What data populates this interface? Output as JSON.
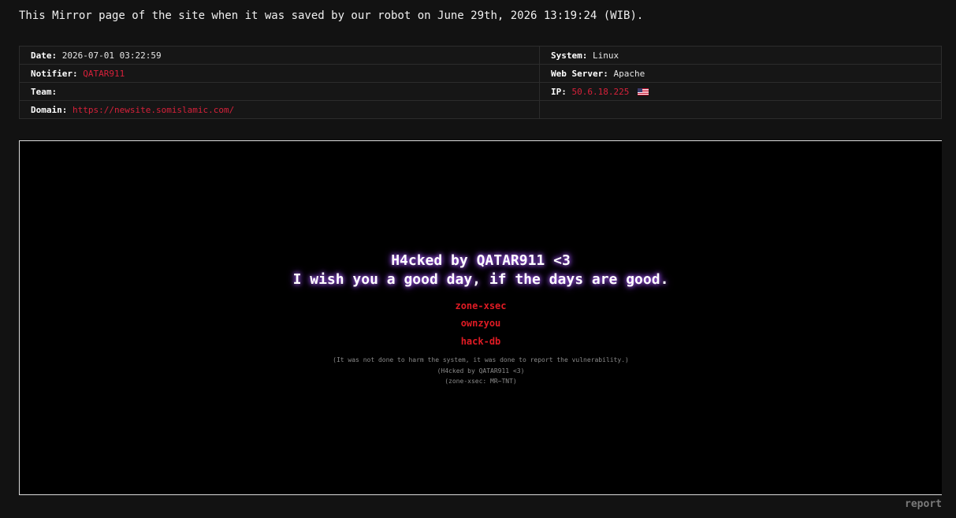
{
  "mirror_note": "This Mirror page of the site when it was saved by our robot on June 29th, 2026 13:19:24 (WIB).",
  "info": {
    "date_label": "Date:",
    "date_value": "2026-07-01 03:22:59",
    "notifier_label": "Notifier:",
    "notifier_value": "QATAR911",
    "team_label": "Team:",
    "team_value": "",
    "domain_label": "Domain:",
    "domain_value": "https://newsite.somislamic.com/",
    "system_label": "System:",
    "system_value": "Linux",
    "webserver_label": "Web Server:",
    "webserver_value": "Apache",
    "ip_label": "IP:",
    "ip_value": "50.6.18.225"
  },
  "mirror": {
    "headline_1": "H4cked by QATAR911 <3",
    "headline_2": "I wish you a good day, if the days are good.",
    "links": [
      "zone-xsec",
      "ownzyou",
      "hack-db"
    ],
    "notes": [
      "(It was not done to harm the system, it was done to report the vulnerability.)",
      "(H4cked by QATAR911 <3)",
      "(zone-xsec: MR~TNT)"
    ]
  },
  "report_label": "report",
  "colors": {
    "background": "#121212",
    "accent_red": "#d6213a",
    "glow_purple": "#b86bff"
  },
  "icons": {
    "ip_flag": "us-flag-icon"
  }
}
